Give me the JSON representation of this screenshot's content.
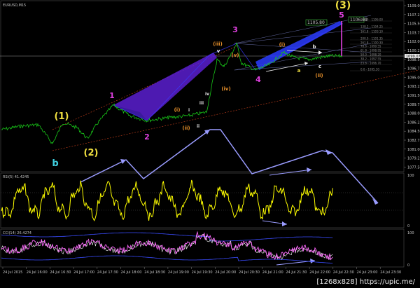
{
  "chart_title": "EURUSD,M15",
  "watermark": "[1268x828] https://upic.me/",
  "colors": {
    "price": "#18c818",
    "rsi": "#ffff00",
    "osc": "#ff66ff",
    "arrow": "#9a9cff",
    "wedge": "#5a1fd0",
    "zigzag": "#3a5cff",
    "wave_yellow": "#f0e040",
    "wave_magenta": "#e040e0",
    "wave_orange": "#e8902a",
    "wave_white": "#e8e8e8",
    "wave_cyan": "#40d0e0",
    "channel": "#c04020"
  },
  "chart_data": [
    {
      "type": "line",
      "name": "price",
      "y_ticks": [
        "1109.00",
        "1107.25",
        "1105.50",
        "1103.75",
        "1102.00",
        "1100.25",
        "1098.50",
        "1096.75",
        "1095.00",
        "1093.25",
        "1091.50",
        "1089.75",
        "1088.00",
        "1086.25",
        "1084.50",
        "1082.75",
        "1081.00",
        "1079.25",
        "1077.50"
      ],
      "last_price": "1099.07",
      "x_ticks": [
        "24 Jul 2015",
        "24 Jul 16:00",
        "24 Jul 16:30",
        "24 Jul 17:00",
        "24 Jul 17:30",
        "24 Jul 18:00",
        "24 Jul 18:30",
        "24 Jul 19:00",
        "24 Jul 19:30",
        "24 Jul 20:00",
        "24 Jul 20:30",
        "24 Jul 21:00",
        "24 Jul 21:30",
        "24 Jul 22:00",
        "24 Jul 22:30",
        "24 Jul 23:00",
        "24 Jul 23:30"
      ],
      "target_box": "1105.80",
      "target_box_right": "1106.69",
      "fib_levels": [
        "100.0 - 1106.00",
        "138.2 - 1104.25",
        "161.8 - 1103.10",
        "200.0 - 1101.35",
        "261.8 - 1100.30",
        "78.6 - 1099.55",
        "61.8 - 1098.95",
        "50.0 - 1098.20",
        "38.2 - 1097.55",
        "23.6 - 1096.70",
        "0.0 - 1095.30"
      ],
      "waves": [
        {
          "label": "(1)",
          "color": "wave_yellow",
          "size": 13
        },
        {
          "label": "(2)",
          "color": "wave_yellow",
          "size": 13
        },
        {
          "label": "(3)",
          "color": "wave_yellow",
          "size": 14
        },
        {
          "label": "b",
          "color": "wave_cyan",
          "size": 13
        },
        {
          "label": "1",
          "color": "wave_magenta",
          "size": 11
        },
        {
          "label": "2",
          "color": "wave_magenta",
          "size": 11
        },
        {
          "label": "3",
          "color": "wave_magenta",
          "size": 11
        },
        {
          "label": "4",
          "color": "wave_magenta",
          "size": 11
        },
        {
          "label": "5",
          "color": "wave_magenta",
          "size": 11
        },
        {
          "label": "(i)",
          "color": "wave_orange",
          "size": 7
        },
        {
          "label": "(ii)",
          "color": "wave_orange",
          "size": 7
        },
        {
          "label": "(iii)",
          "color": "wave_orange",
          "size": 7
        },
        {
          "label": "(iv)",
          "color": "wave_orange",
          "size": 7
        },
        {
          "label": "(v)",
          "color": "wave_orange",
          "size": 7
        },
        {
          "label": "(i)",
          "color": "wave_orange",
          "size": 7
        },
        {
          "label": "(ii)",
          "color": "wave_orange",
          "size": 7
        },
        {
          "label": "i",
          "color": "wave_white",
          "size": 6
        },
        {
          "label": "ii",
          "color": "wave_white",
          "size": 6
        },
        {
          "label": "iii",
          "color": "wave_white",
          "size": 6
        },
        {
          "label": "iv",
          "color": "wave_white",
          "size": 6
        },
        {
          "label": "v",
          "color": "wave_white",
          "size": 7
        },
        {
          "label": "a",
          "color": "wave_yellow",
          "size": 7
        },
        {
          "label": "b",
          "color": "wave_white",
          "size": 7
        },
        {
          "label": "c",
          "color": "wave_white",
          "size": 7
        }
      ]
    },
    {
      "type": "line",
      "name": "rsi",
      "title": "RSI(5) 41.4245",
      "y_ticks": [
        "100",
        "0"
      ]
    },
    {
      "type": "line",
      "name": "oscillator",
      "title": "CCI(14) 26.4274",
      "y_ticks": [
        "100",
        "0"
      ]
    }
  ]
}
